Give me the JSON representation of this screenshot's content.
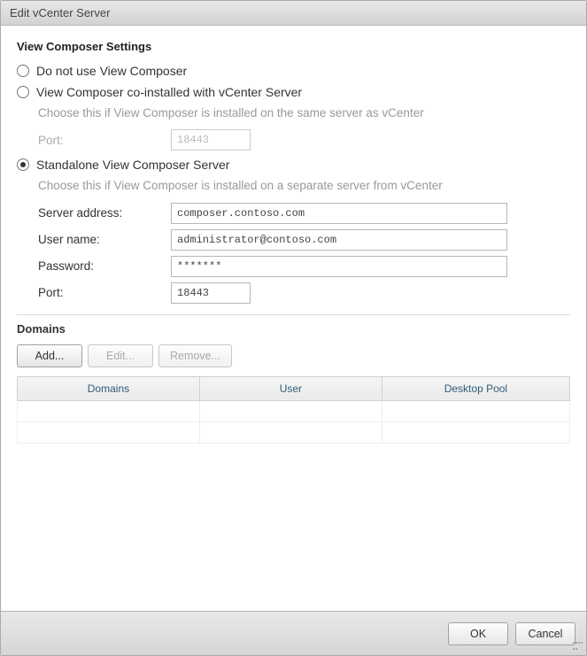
{
  "window": {
    "title": "Edit vCenter Server"
  },
  "section": {
    "title": "View Composer Settings"
  },
  "options": {
    "noComposer": {
      "label": "Do not use View Composer"
    },
    "coInstalled": {
      "label": "View Composer co-installed with vCenter Server",
      "description": "Choose this if View Composer is installed on the same server as vCenter",
      "portLabel": "Port:",
      "portValue": "18443"
    },
    "standalone": {
      "label": "Standalone View Composer Server",
      "description": "Choose this if View Composer is installed on a separate server from vCenter",
      "serverAddressLabel": "Server address:",
      "serverAddressValue": "composer.contoso.com",
      "userNameLabel": "User name:",
      "userNameValue": "administrator@contoso.com",
      "passwordLabel": "Password:",
      "passwordValue": "*******",
      "portLabel": "Port:",
      "portValue": "18443"
    }
  },
  "domains": {
    "title": "Domains",
    "buttons": {
      "add": "Add...",
      "edit": "Edit...",
      "remove": "Remove..."
    },
    "columns": {
      "domains": "Domains",
      "user": "User",
      "desktopPool": "Desktop Pool"
    }
  },
  "footer": {
    "ok": "OK",
    "cancel": "Cancel"
  }
}
